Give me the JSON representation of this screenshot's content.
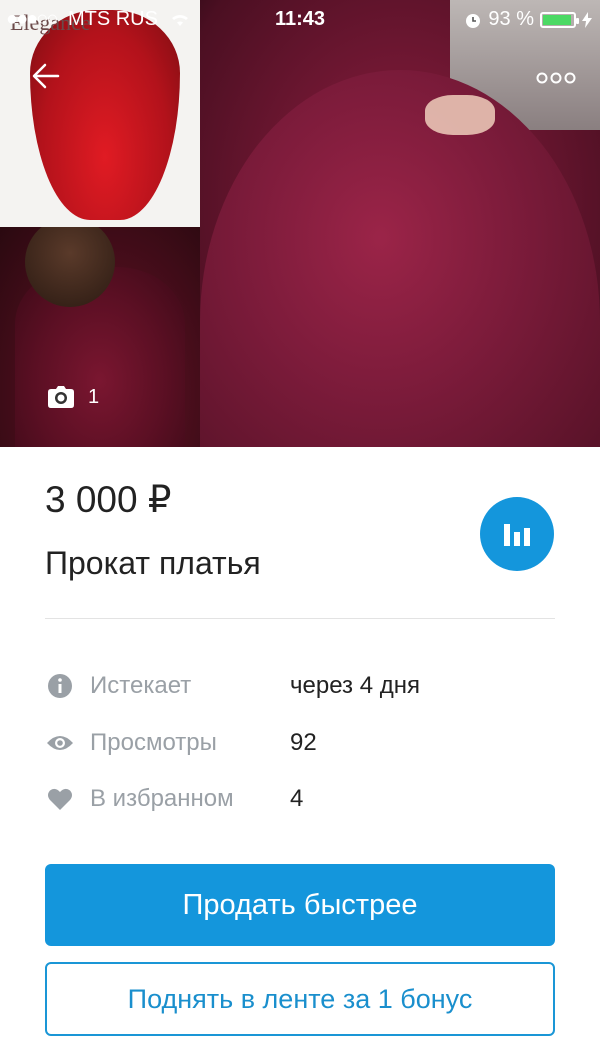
{
  "status_bar": {
    "signal_dots": "●●●○○",
    "carrier": "MTS RUS",
    "time": "11:43",
    "battery_percent": "93 %",
    "battery_level": 0.93
  },
  "gallery": {
    "photo_count": "1",
    "logo_text": "Elegance"
  },
  "listing": {
    "price": "3 000 ₽",
    "title": "Прокат платья"
  },
  "info": {
    "expires_label": "Истекает",
    "expires_value": "через 4 дня",
    "views_label": "Просмотры",
    "views_value": "92",
    "favorites_label": "В избранном",
    "favorites_value": "4"
  },
  "actions": {
    "sell_faster": "Продать быстрее",
    "bump": "Поднять в ленте за 1 бонус"
  },
  "colors": {
    "accent": "#1496dc",
    "battery": "#4cd964"
  }
}
